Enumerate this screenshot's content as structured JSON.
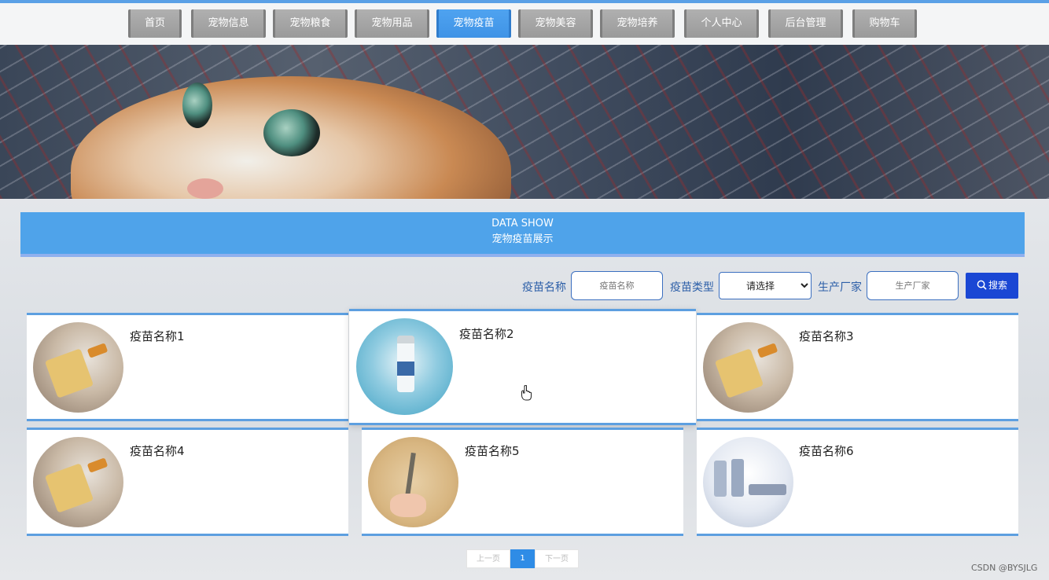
{
  "nav": {
    "items": [
      {
        "label": "首页",
        "active": false
      },
      {
        "label": "宠物信息",
        "active": false
      },
      {
        "label": "宠物粮食",
        "active": false
      },
      {
        "label": "宠物用品",
        "active": false
      },
      {
        "label": "宠物疫苗",
        "active": true
      },
      {
        "label": "宠物美容",
        "active": false
      },
      {
        "label": "宠物培养",
        "active": false
      },
      {
        "label": "个人中心",
        "active": false
      },
      {
        "label": "后台管理",
        "active": false
      },
      {
        "label": "购物车",
        "active": false
      }
    ]
  },
  "panel": {
    "title_en": "DATA SHOW",
    "title_cn": "宠物疫苗展示"
  },
  "search": {
    "name_label": "疫苗名称",
    "name_placeholder": "疫苗名称",
    "type_label": "疫苗类型",
    "type_selected": "请选择",
    "maker_label": "生产厂家",
    "maker_placeholder": "生产厂家",
    "button_label": "搜索"
  },
  "cards": [
    {
      "name": "疫苗名称1",
      "thumb": "yellow-vial"
    },
    {
      "name": "疫苗名称2",
      "thumb": "blue-vial"
    },
    {
      "name": "疫苗名称3",
      "thumb": "yellow-vial"
    },
    {
      "name": "疫苗名称4",
      "thumb": "yellow-vial"
    },
    {
      "name": "疫苗名称5",
      "thumb": "hand-syringe"
    },
    {
      "name": "疫苗名称6",
      "thumb": "glass-vials"
    }
  ],
  "pagination": {
    "prev_label": "上一页",
    "current": "1",
    "next_label": "下一页"
  },
  "watermark": "CSDN @BYSJLG",
  "colors": {
    "accent": "#4fa3ea",
    "nav_inactive": "#a6a6a6",
    "search_button": "#1a47d4",
    "label_text": "#2d5fa8"
  }
}
